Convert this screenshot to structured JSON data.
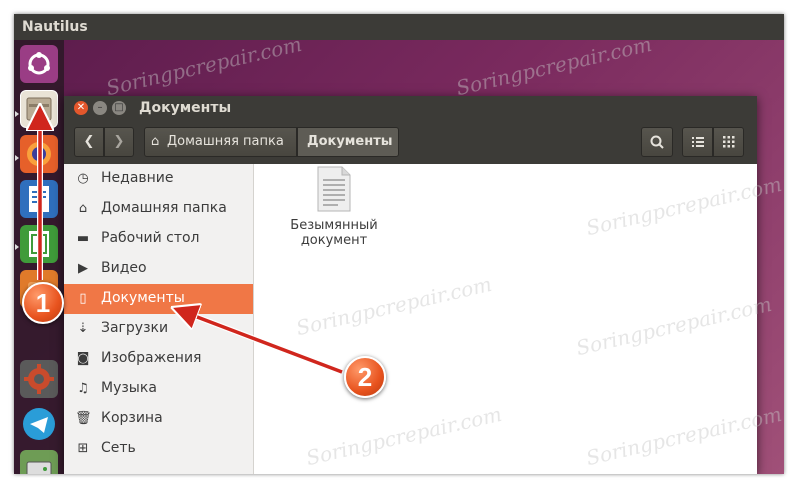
{
  "topbar": {
    "app_name": "Nautilus"
  },
  "launcher": {
    "items": [
      {
        "name": "ubuntu-dash-icon",
        "color": "#9a3d85"
      },
      {
        "name": "files-icon",
        "color": "#e9e3d6"
      },
      {
        "name": "firefox-icon",
        "color": "#e6602a"
      },
      {
        "name": "writer-icon",
        "color": "#2f6fbd"
      },
      {
        "name": "calc-icon",
        "color": "#3f9b3a"
      },
      {
        "name": "software-center-icon",
        "color": "#e07a2a"
      },
      {
        "name": "settings-icon",
        "color": "#c94b2c"
      },
      {
        "name": "telegram-icon",
        "color": "#2a9dd8"
      },
      {
        "name": "disk-icon",
        "color": "#6e9c55"
      }
    ]
  },
  "window": {
    "title": "Документы",
    "breadcrumbs": [
      {
        "label": "Домашняя папка",
        "icon": "home-icon"
      },
      {
        "label": "Документы"
      }
    ]
  },
  "sidebar": {
    "items": [
      {
        "label": "Недавние",
        "icon": "clock-icon"
      },
      {
        "label": "Домашняя папка",
        "icon": "home-icon"
      },
      {
        "label": "Рабочий стол",
        "icon": "folder-icon"
      },
      {
        "label": "Видео",
        "icon": "video-icon"
      },
      {
        "label": "Документы",
        "icon": "document-icon",
        "active": true
      },
      {
        "label": "Загрузки",
        "icon": "download-icon"
      },
      {
        "label": "Изображения",
        "icon": "camera-icon"
      },
      {
        "label": "Музыка",
        "icon": "music-icon"
      },
      {
        "label": "Корзина",
        "icon": "trash-icon"
      },
      {
        "label": "Сеть",
        "icon": "network-icon"
      }
    ]
  },
  "files": [
    {
      "line1": "Безымянный",
      "line2": "документ",
      "icon": "text-file-icon"
    }
  ],
  "annotations": [
    {
      "number": "1"
    },
    {
      "number": "2"
    }
  ],
  "watermark": "Soringpcrepair.com",
  "colors": {
    "accent": "#f07746",
    "arrow": "#d0261d",
    "panel": "#3c3b37"
  }
}
